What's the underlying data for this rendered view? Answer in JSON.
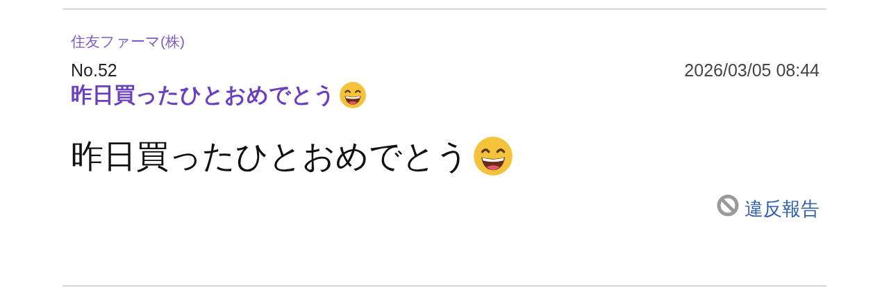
{
  "post": {
    "company": "住友ファーマ(株)",
    "number": "No.52",
    "timestamp": "2026/03/05 08:44",
    "title": "昨日買ったひとおめでとう",
    "body": "昨日買ったひとおめでとう",
    "report_link": "違反報告"
  }
}
